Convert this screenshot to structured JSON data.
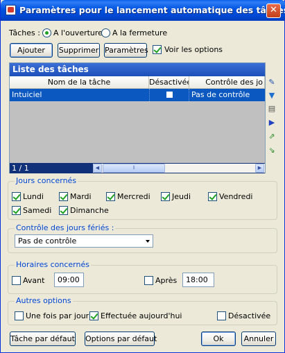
{
  "window": {
    "title": "Paramètres pour le lancement automatique des tâches",
    "close_label": "✕"
  },
  "taches": {
    "label": "Tâches :",
    "options": [
      "A l'ouverture",
      "A la fermeture"
    ],
    "selected": "A l'ouverture"
  },
  "toolbar": {
    "ajouter": "Ajouter",
    "supprimer": "Supprimer",
    "parametres": "Paramètres",
    "voir_options": "Voir les options",
    "voir_options_checked": true
  },
  "table": {
    "title": "Liste des tâches",
    "columns": [
      "Nom de la tâche",
      "Désactivée",
      "Contrôle des jo"
    ],
    "rows": [
      {
        "name": "Intuiciel",
        "desactivee": false,
        "controle": "Pas de contrôle"
      }
    ],
    "counter": "1 / 1",
    "side_icons": [
      "edit-icon",
      "cup-icon",
      "print-icon",
      "arrow-right-icon",
      "export-icon",
      "import-icon"
    ]
  },
  "jours": {
    "title": "Jours concernés",
    "days": [
      {
        "label": "Lundi",
        "checked": true
      },
      {
        "label": "Mardi",
        "checked": true
      },
      {
        "label": "Mercredi",
        "checked": true
      },
      {
        "label": "Jeudi",
        "checked": true
      },
      {
        "label": "Vendredi",
        "checked": true
      },
      {
        "label": "Samedi",
        "checked": true
      },
      {
        "label": "Dimanche",
        "checked": true
      }
    ]
  },
  "feries": {
    "title": "Contrôle des jours fériés :",
    "value": "Pas de contrôle"
  },
  "horaires": {
    "title": "Horaires concernés",
    "avant_label": "Avant",
    "avant_checked": false,
    "avant_value": "09:00",
    "apres_label": "Après",
    "apres_checked": false,
    "apres_value": "18:00"
  },
  "autres": {
    "title": "Autres options",
    "options": [
      {
        "label": "Une fois par jour",
        "checked": false
      },
      {
        "label": "Effectuée aujourd'hui",
        "checked": true
      },
      {
        "label": "Désactivée",
        "checked": false
      }
    ]
  },
  "footer": {
    "tache_defaut": "Tâche par défaut",
    "options_defaut": "Options par défaut",
    "ok": "Ok",
    "annuler": "Annuler"
  }
}
